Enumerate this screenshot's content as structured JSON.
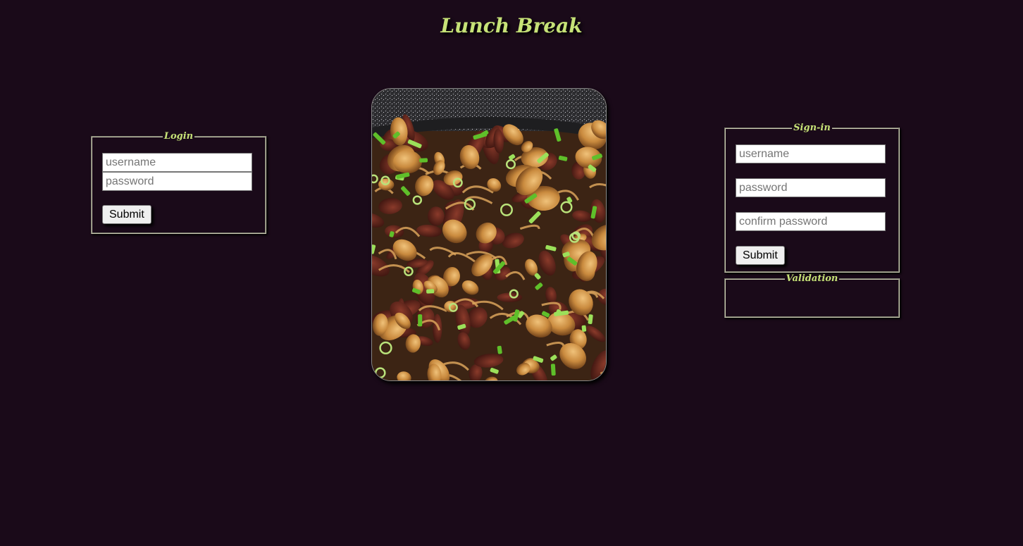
{
  "header": {
    "title": "Lunch Break"
  },
  "login": {
    "legend": "Login",
    "username_placeholder": "username",
    "password_placeholder": "password",
    "submit_label": "Submit"
  },
  "signin": {
    "legend": "Sign-in",
    "username_placeholder": "username",
    "password_placeholder": "password",
    "confirm_placeholder": "confirm password",
    "submit_label": "Submit"
  },
  "validation": {
    "legend": "Validation"
  },
  "hero_image": {
    "subject": "beef and mushroom stir-fry with green onions in a pan"
  },
  "colors": {
    "background": "#1a0a19",
    "accent": "#c6e277"
  }
}
